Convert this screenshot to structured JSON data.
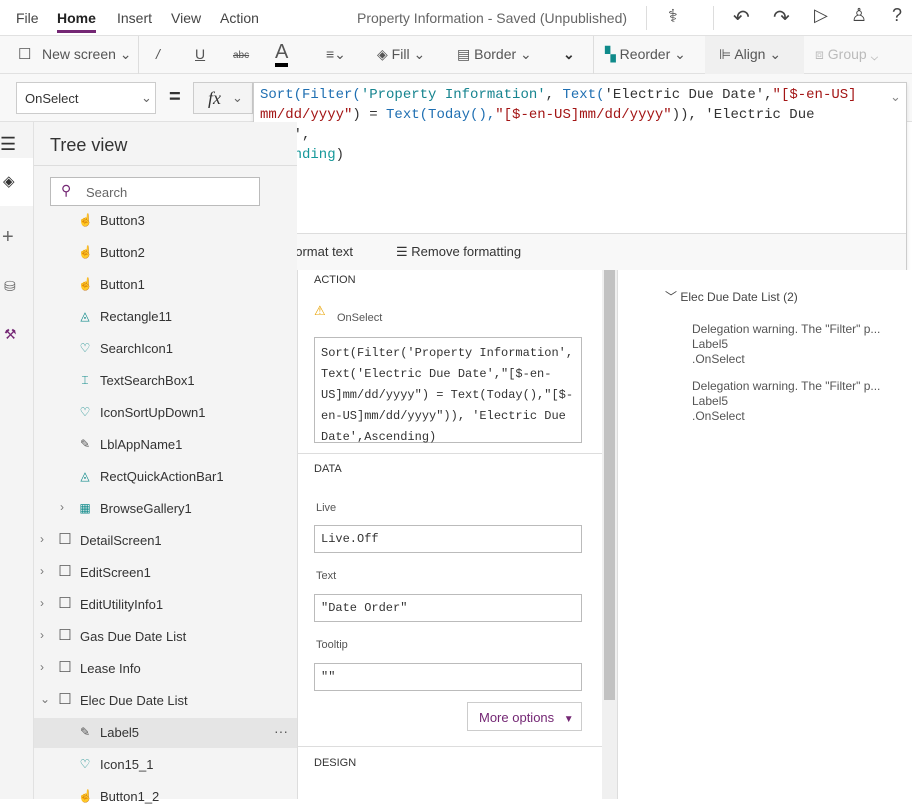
{
  "menu": {
    "items": [
      "File",
      "Home",
      "Insert",
      "View",
      "Action"
    ],
    "active": "Home",
    "title": "Property Information - Saved (Unpublished)"
  },
  "toolbar": {
    "new_screen": "New screen",
    "fill": "Fill",
    "border": "Border",
    "reorder": "Reorder",
    "align": "Align",
    "group": "Group"
  },
  "formula_bar": {
    "property": "OnSelect",
    "equals": "=",
    "fx": "fx",
    "segments": [
      {
        "t": "Sort(Filter(",
        "c": "#1f6fb2"
      },
      {
        "t": "'Property Information'",
        "c": "#16848f"
      },
      {
        "t": ", ",
        "c": "#333"
      },
      {
        "t": "Text(",
        "c": "#1f6fb2"
      },
      {
        "t": "'Electric Due Date'",
        "c": "#333"
      },
      {
        "t": ",",
        "c": "#333"
      },
      {
        "t": "\"[$-en-US]\nmm/dd/yyyy\"",
        "c": "#a31515"
      },
      {
        "t": ") = ",
        "c": "#333"
      },
      {
        "t": "Text(Today(),",
        "c": "#1f6fb2"
      },
      {
        "t": "\"[$-en-US]mm/dd/yyyy\"",
        "c": "#a31515"
      },
      {
        "t": ")), ",
        "c": "#333"
      },
      {
        "t": "'Electric Due Date'",
        "c": "#333"
      },
      {
        "t": ",\n",
        "c": "#333"
      },
      {
        "t": "Ascending",
        "c": "#16989a"
      },
      {
        "t": ")",
        "c": "#333"
      }
    ],
    "format_text": "Format text",
    "remove_formatting": "Remove formatting"
  },
  "tree": {
    "title": "Tree view",
    "search_placeholder": "Search",
    "items": [
      {
        "label": "Button3",
        "level": 2,
        "icon": "button-icon"
      },
      {
        "label": "Button2",
        "level": 2,
        "icon": "button-icon"
      },
      {
        "label": "Button1",
        "level": 2,
        "icon": "button-icon"
      },
      {
        "label": "Rectangle11",
        "level": 2,
        "icon": "shape-icon"
      },
      {
        "label": "SearchIcon1",
        "level": 2,
        "icon": "icon-control-icon"
      },
      {
        "label": "TextSearchBox1",
        "level": 2,
        "icon": "text-input-icon"
      },
      {
        "label": "IconSortUpDown1",
        "level": 2,
        "icon": "icon-control-icon"
      },
      {
        "label": "LblAppName1",
        "level": 2,
        "icon": "label-icon"
      },
      {
        "label": "RectQuickActionBar1",
        "level": 2,
        "icon": "shape-icon"
      },
      {
        "label": "BrowseGallery1",
        "level": 2,
        "icon": "gallery-icon",
        "chevron": "right"
      },
      {
        "label": "DetailScreen1",
        "level": 1,
        "icon": "screen-icon",
        "chevron": "right"
      },
      {
        "label": "EditScreen1",
        "level": 1,
        "icon": "screen-icon",
        "chevron": "right"
      },
      {
        "label": "EditUtilityInfo1",
        "level": 1,
        "icon": "screen-icon",
        "chevron": "right"
      },
      {
        "label": "Gas Due Date List",
        "level": 1,
        "icon": "screen-icon",
        "chevron": "right"
      },
      {
        "label": "Lease Info",
        "level": 1,
        "icon": "screen-icon",
        "chevron": "right"
      },
      {
        "label": "Elec Due Date List",
        "level": 1,
        "icon": "screen-icon",
        "chevron": "down"
      },
      {
        "label": "Label5",
        "level": 2,
        "icon": "label-icon",
        "selected": true
      },
      {
        "label": "Icon15_1",
        "level": 2,
        "icon": "icon-control-icon"
      },
      {
        "label": "Button1_2",
        "level": 2,
        "icon": "button-icon"
      }
    ],
    "more": "···"
  },
  "props": {
    "action_heading": "ACTION",
    "onselect_label": "OnSelect",
    "onselect_value": "Sort(Filter('Property Information', Text('Electric Due Date',\"[$-en-US]mm/dd/yyyy\") = Text(Today(),\"[$-en-US]mm/dd/yyyy\")), 'Electric Due Date',Ascending)",
    "data_heading": "DATA",
    "live_label": "Live",
    "live_value": "Live.Off",
    "text_label": "Text",
    "text_value": "\"Date Order\"",
    "tooltip_label": "Tooltip",
    "tooltip_value": "\"\"",
    "more_options": "More options",
    "design_heading": "DESIGN"
  },
  "issues": {
    "group": "Elec Due Date List (2)",
    "items": [
      {
        "message": "Delegation warning. The \"Filter\" p...",
        "control": "Label5",
        "property": ".OnSelect"
      },
      {
        "message": "Delegation warning. The \"Filter\" p...",
        "control": "Label5",
        "property": ".OnSelect"
      }
    ]
  },
  "colors": {
    "accent": "#742774",
    "selected_row": "#e5e5e5",
    "warning": "#e8a200"
  }
}
